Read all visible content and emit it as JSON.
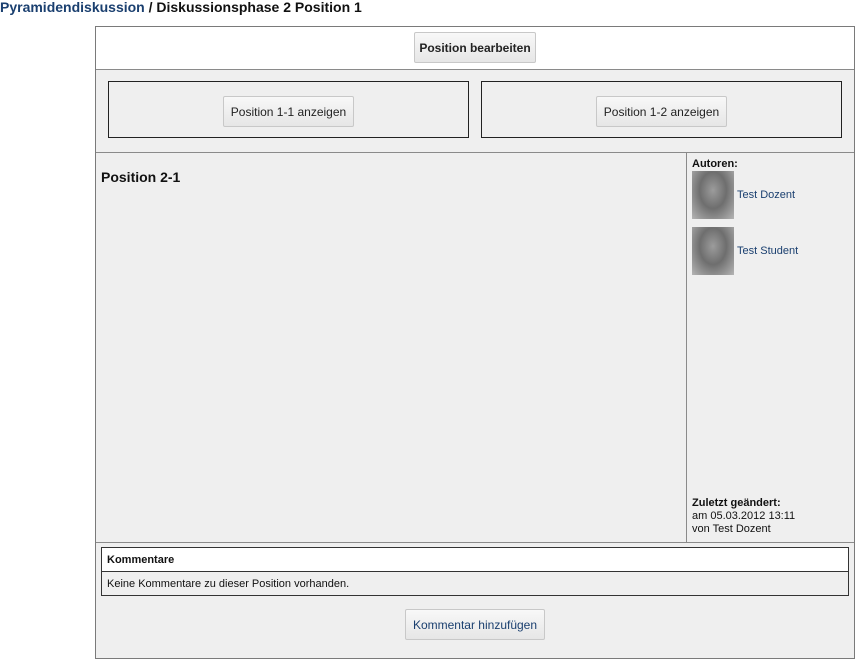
{
  "breadcrumb": {
    "parent": "Pyramidendiskussion",
    "separator": " / ",
    "current": "Diskussionsphase 2 Position 1"
  },
  "toolbar": {
    "edit_label": "Position bearbeiten"
  },
  "compare": {
    "left_label": "Position 1-1 anzeigen",
    "right_label": "Position 1-2 anzeigen"
  },
  "position": {
    "title": "Position 2-1"
  },
  "sidebar": {
    "authors_heading": "Autoren:",
    "authors": [
      {
        "name": "Test Dozent"
      },
      {
        "name": "Test Student"
      }
    ],
    "changed_heading": "Zuletzt geändert:",
    "changed_date": "am 05.03.2012 13:11",
    "changed_by": "von Test Dozent"
  },
  "comments": {
    "heading": "Kommentare",
    "empty_text": "Keine Kommentare zu dieser Position vorhanden.",
    "add_label": "Kommentar hinzufügen"
  },
  "colors": {
    "link": "#1a3f6f",
    "panel_bg": "#efefef",
    "border": "#7a7a7a"
  }
}
